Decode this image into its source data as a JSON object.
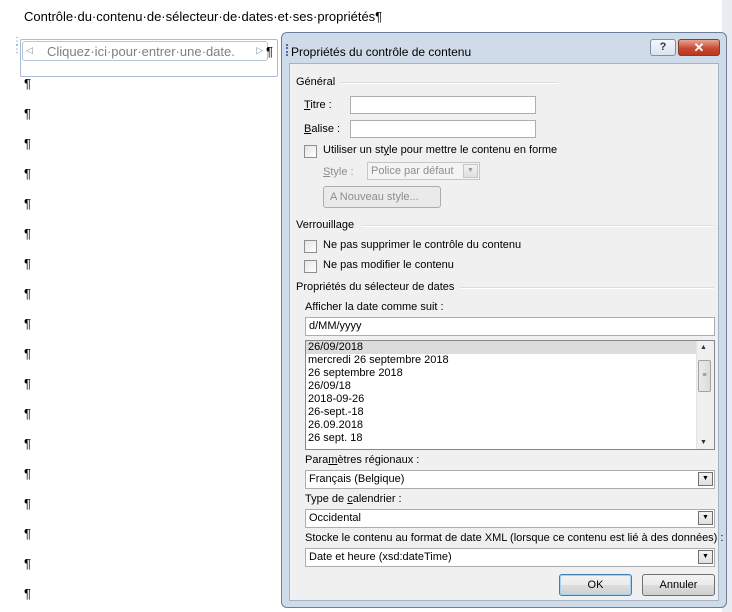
{
  "document": {
    "heading": "Contrôle·du·contenu·de·sélecteur·de·dates·et·ses·propriétés¶",
    "content_control_placeholder": "Cliquez·ici·pour·entrer·une·date.",
    "pilcrow": "¶"
  },
  "dialog": {
    "title": "Propriétés du contrôle de contenu",
    "help_button": "?",
    "close_button": "✕",
    "general": {
      "heading": "Général",
      "title_label": "Titre :",
      "title_value": "",
      "tag_label": "Balise :",
      "tag_value": "",
      "use_style_label": "Utiliser un style pour mettre le contenu en forme",
      "style_label": "Style :",
      "style_value": "Police par défaut",
      "new_style_button": "Nouveau style..."
    },
    "locking": {
      "heading": "Verrouillage",
      "no_delete_label": "Ne pas supprimer le contrôle du contenu",
      "no_edit_label": "Ne pas modifier le contenu"
    },
    "date_picker": {
      "heading": "Propriétés du sélecteur de dates",
      "display_format_label": "Afficher la date comme suit :",
      "display_format_value": "d/MM/yyyy",
      "formats": [
        "26/09/2018",
        "mercredi 26 septembre 2018",
        "26 septembre 2018",
        "26/09/18",
        "2018-09-26",
        "26-sept.-18",
        "26.09.2018",
        "26 sept. 18"
      ],
      "locale_label": "Paramètres régionaux :",
      "locale_value": "Français (Belgique)",
      "calendar_label": "Type de calendrier :",
      "calendar_value": "Occidental",
      "xml_label": "Stocke le contenu au format de date XML (lorsque ce contenu est lié à des données) :",
      "xml_value": "Date et heure (xsd:dateTime)"
    },
    "ok_button": "OK",
    "cancel_button": "Annuler"
  }
}
